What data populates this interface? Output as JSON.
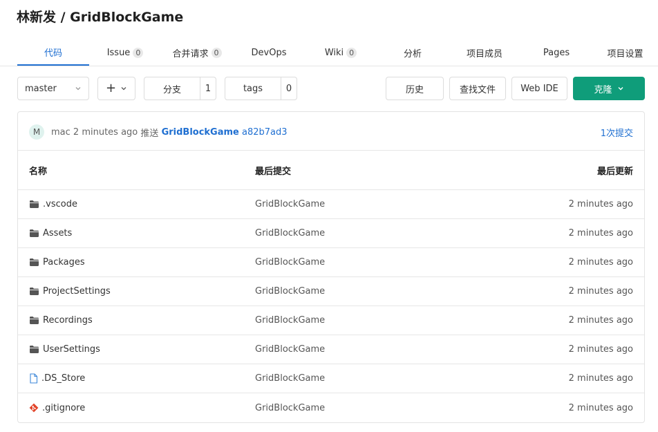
{
  "header": {
    "title": "林新发 / GridBlockGame"
  },
  "tabs": [
    {
      "label": "代码",
      "count": null
    },
    {
      "label": "Issue",
      "count": "0"
    },
    {
      "label": "合并请求",
      "count": "0"
    },
    {
      "label": "DevOps",
      "count": null
    },
    {
      "label": "Wiki",
      "count": "0"
    },
    {
      "label": "分析",
      "count": null
    },
    {
      "label": "项目成员",
      "count": null
    },
    {
      "label": "Pages",
      "count": null
    },
    {
      "label": "项目设置",
      "count": null
    }
  ],
  "toolbar": {
    "branch": "master",
    "add": "+",
    "branches_label": "分支",
    "branches_count": "1",
    "tags_label": "tags",
    "tags_count": "0",
    "history": "历史",
    "find_file": "查找文件",
    "web_ide": "Web IDE",
    "clone": "克隆"
  },
  "commit": {
    "avatar": "M",
    "author": "mac",
    "time": "2 minutes ago",
    "action": "推送",
    "message": "GridBlockGame",
    "sha": "a82b7ad3",
    "count_label": "1次提交"
  },
  "table": {
    "headers": {
      "name": "名称",
      "last_commit": "最后提交",
      "last_update": "最后更新"
    },
    "rows": [
      {
        "name": ".vscode",
        "type": "folder",
        "commit": "GridBlockGame",
        "updated": "2 minutes ago"
      },
      {
        "name": "Assets",
        "type": "folder",
        "commit": "GridBlockGame",
        "updated": "2 minutes ago"
      },
      {
        "name": "Packages",
        "type": "folder",
        "commit": "GridBlockGame",
        "updated": "2 minutes ago"
      },
      {
        "name": "ProjectSettings",
        "type": "folder",
        "commit": "GridBlockGame",
        "updated": "2 minutes ago"
      },
      {
        "name": "Recordings",
        "type": "folder",
        "commit": "GridBlockGame",
        "updated": "2 minutes ago"
      },
      {
        "name": "UserSettings",
        "type": "folder",
        "commit": "GridBlockGame",
        "updated": "2 minutes ago"
      },
      {
        "name": ".DS_Store",
        "type": "file",
        "commit": "GridBlockGame",
        "updated": "2 minutes ago"
      },
      {
        "name": ".gitignore",
        "type": "git",
        "commit": "GridBlockGame",
        "updated": "2 minutes ago"
      }
    ]
  },
  "colors": {
    "accent": "#1f6fd1",
    "primary": "#0f9d7a",
    "git_icon": "#e24329",
    "folder_icon": "#555555"
  }
}
